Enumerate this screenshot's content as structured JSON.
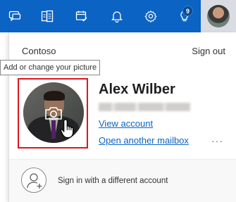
{
  "topbar": {
    "icons": [
      "chat-icon",
      "todo-icon",
      "calendar-check-icon",
      "bell-icon",
      "gear-icon",
      "lightbulb-icon"
    ],
    "notification_count": "9",
    "accent_color": "#0b63c4"
  },
  "panel": {
    "org_name": "Contoso",
    "sign_out_label": "Sign out",
    "tooltip": "Add or change your picture",
    "user_name": "Alex Wilber",
    "view_account_label": "View account",
    "open_mailbox_label": "Open another mailbox",
    "more_label": "···",
    "sign_in_other_label": "Sign in with a different account"
  },
  "colors": {
    "highlight_frame": "#e0151a",
    "link": "#0b63c4"
  }
}
